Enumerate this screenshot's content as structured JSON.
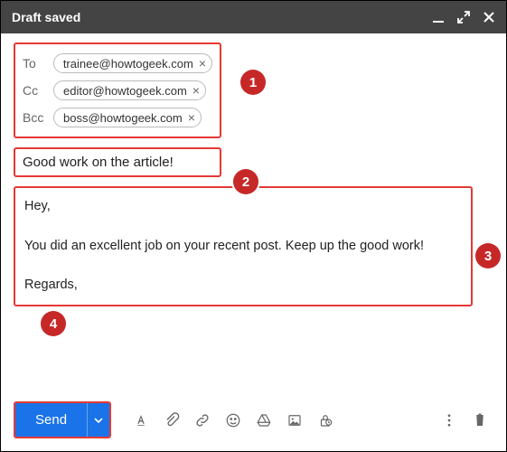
{
  "header": {
    "title": "Draft saved"
  },
  "recipients": {
    "to_label": "To",
    "to_value": "trainee@howtogeek.com",
    "cc_label": "Cc",
    "cc_value": "editor@howtogeek.com",
    "bcc_label": "Bcc",
    "bcc_value": "boss@howtogeek.com"
  },
  "subject": "Good work on the article!",
  "body_text": "Hey,\n\nYou did an excellent job on your recent post. Keep up the good work!\n\nRegards,",
  "annotations": {
    "n1": "1",
    "n2": "2",
    "n3": "3",
    "n4": "4"
  },
  "toolbar": {
    "send_label": "Send"
  }
}
